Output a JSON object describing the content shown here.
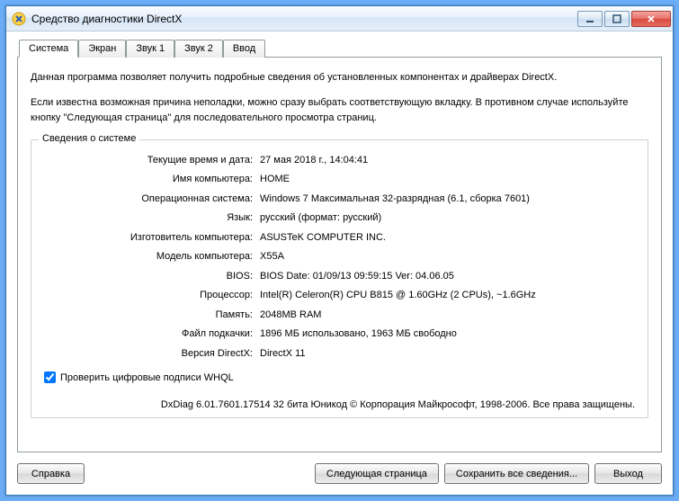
{
  "window": {
    "title": "Средство диагностики DirectX"
  },
  "tabs": {
    "system": "Система",
    "screen": "Экран",
    "sound1": "Звук 1",
    "sound2": "Звук 2",
    "input": "Ввод"
  },
  "intro": {
    "p1": "Данная программа позволяет получить подробные сведения об установленных компонентах и драйверах DirectX.",
    "p2": "Если известна возможная причина неполадки, можно сразу выбрать соответствующую вкладку. В противном случае используйте кнопку \"Следующая страница\" для последовательного просмотра страниц."
  },
  "group": {
    "title": "Сведения о системе"
  },
  "info": {
    "datetime_label": "Текущие время и дата:",
    "datetime_value": "27 мая 2018 г., 14:04:41",
    "computername_label": "Имя компьютера:",
    "computername_value": "HOME",
    "os_label": "Операционная система:",
    "os_value": "Windows 7 Максимальная 32-разрядная (6.1, сборка 7601)",
    "lang_label": "Язык:",
    "lang_value": "русский (формат: русский)",
    "manufacturer_label": "Изготовитель компьютера:",
    "manufacturer_value": "ASUSTeK COMPUTER INC.",
    "model_label": "Модель компьютера:",
    "model_value": "X55A",
    "bios_label": "BIOS:",
    "bios_value": "BIOS Date: 01/09/13 09:59:15 Ver: 04.06.05",
    "cpu_label": "Процессор:",
    "cpu_value": "Intel(R) Celeron(R) CPU B815 @ 1.60GHz (2 CPUs), ~1.6GHz",
    "memory_label": "Память:",
    "memory_value": "2048MB RAM",
    "pagefile_label": "Файл подкачки:",
    "pagefile_value": "1896 МБ использовано, 1963 МБ свободно",
    "directx_label": "Версия DirectX:",
    "directx_value": "DirectX 11"
  },
  "whql": {
    "label": "Проверить цифровые подписи WHQL"
  },
  "footer": {
    "text": "DxDiag 6.01.7601.17514 32 бита Юникод   © Корпорация Майкрософт, 1998-2006.  Все права защищены."
  },
  "buttons": {
    "help": "Справка",
    "next": "Следующая страница",
    "save": "Сохранить все сведения...",
    "exit": "Выход"
  }
}
